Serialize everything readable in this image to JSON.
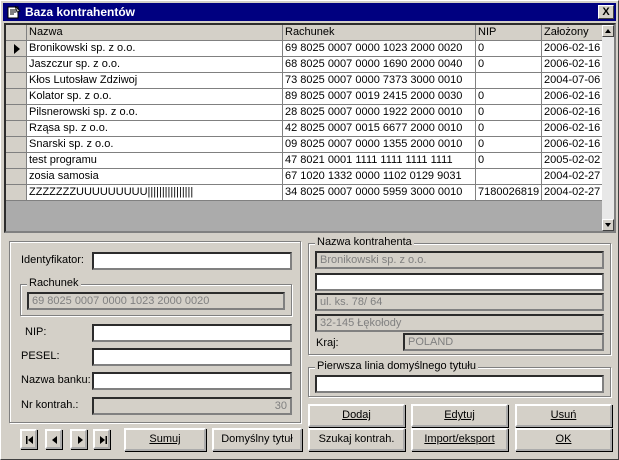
{
  "window": {
    "title": "Baza kontrahentów",
    "close": "X"
  },
  "grid": {
    "headers": [
      "Nazwa",
      "Rachunek",
      "NIP",
      "Założony"
    ],
    "rows": [
      [
        "Bronikowski sp. z o.o.",
        "69 8025 0007 0000 1023 2000 0020",
        "0",
        "2006-02-16"
      ],
      [
        "Jaszczur sp. z o.o.",
        "68 8025 0007 0000 1690 2000 0040",
        "0",
        "2006-02-16"
      ],
      [
        "Kłos Lutosław Zdziwoj",
        "73 8025 0007 0000 7373 3000 0010",
        "",
        "2004-07-06"
      ],
      [
        "Kolator sp. z o.o.",
        "89 8025 0007 0019 2415 2000 0030",
        "0",
        "2006-02-16"
      ],
      [
        "Pilsnerowski sp. z o.o.",
        "28 8025 0007 0000 1922 2000 0010",
        "0",
        "2006-02-16"
      ],
      [
        "Rząsa sp. z o.o.",
        "42 8025 0007 0015 6677 2000 0010",
        "0",
        "2006-02-16"
      ],
      [
        "Snarski sp. z o.o.",
        "09 8025 0007 0000 1355 2000 0010",
        "0",
        "2006-02-16"
      ],
      [
        "test programu",
        "47 8021 0001 1111 1111 1111 1111",
        "0",
        "2005-02-02"
      ],
      [
        "zosia samosia",
        "67 1020 1332 0000 1102 0129 9031",
        "",
        "2004-02-27"
      ],
      [
        "ZZZZZZZUUUUUUUUU||||||||||||||||",
        "34 8025 0007 0000 5959 3000 0010",
        "7180026819",
        "2004-02-27"
      ]
    ]
  },
  "form": {
    "identyfikator_label": "Identyfikator:",
    "identyfikator_value": "",
    "rachunek_group": "Rachunek",
    "rachunek_value": "69 8025 0007 0000 1023 2000 0020",
    "nip_label": "NIP:",
    "nip_value": "",
    "pesel_label": "PESEL:",
    "pesel_value": "",
    "bank_label": "Nazwa banku:",
    "bank_value": "",
    "nr_label": "Nr kontrah.:",
    "nr_value": "30",
    "nazwa_group": "Nazwa kontrahenta",
    "nazwa1": "Bronikowski sp. z o.o.",
    "nazwa2": "",
    "ulica": "ul. ks.  78/ 64",
    "miasto": "32-145 Łękołody",
    "kraj_label": "Kraj:",
    "kraj_value": "POLAND",
    "tytul_group": "Pierwsza linia domyślnego tytułu",
    "tytul_value": ""
  },
  "buttons": {
    "dodaj": "Dodaj",
    "edytuj": "Edytuj",
    "usun": "Usuń",
    "sumuj": "Sumuj",
    "domyslny": "Domyślny tytuł",
    "szukaj": "Szukaj kontrah.",
    "import": "Import/eksport",
    "ok": "OK"
  },
  "nav": {
    "first": "|◀",
    "prev": "◀",
    "next": "▶",
    "last": "▶|"
  }
}
